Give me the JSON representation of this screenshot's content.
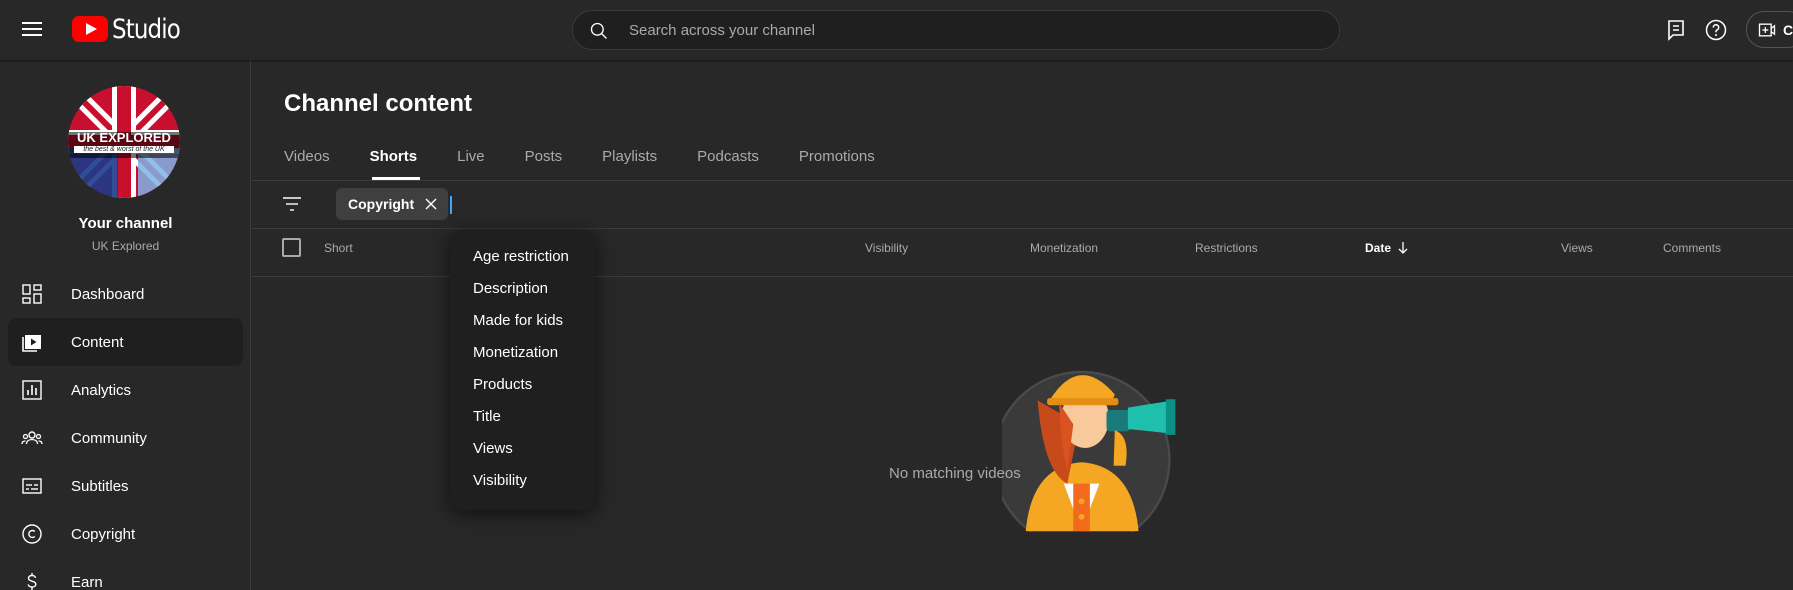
{
  "app": {
    "brand": "Studio"
  },
  "search": {
    "placeholder": "Search across your channel"
  },
  "topbar": {
    "create_label": "C"
  },
  "channel": {
    "name": "Your channel",
    "handle": "UK Explored",
    "avatar_text_main": "UK EXPLORED",
    "avatar_text_sub": "the best & worst of the UK"
  },
  "sidebar": {
    "items": [
      {
        "label": "Dashboard",
        "icon": "dashboard-icon"
      },
      {
        "label": "Content",
        "icon": "content-icon",
        "active": true
      },
      {
        "label": "Analytics",
        "icon": "analytics-icon"
      },
      {
        "label": "Community",
        "icon": "community-icon"
      },
      {
        "label": "Subtitles",
        "icon": "subtitles-icon"
      },
      {
        "label": "Copyright",
        "icon": "copyright-icon"
      },
      {
        "label": "Earn",
        "icon": "earn-icon"
      }
    ]
  },
  "main": {
    "title": "Channel content",
    "tabs": [
      "Videos",
      "Shorts",
      "Live",
      "Posts",
      "Playlists",
      "Podcasts",
      "Promotions"
    ],
    "active_tab": "Shorts",
    "filter_chip": "Copyright",
    "columns": [
      "Short",
      "Visibility",
      "Monetization",
      "Restrictions",
      "Date",
      "Views",
      "Comments"
    ],
    "sorted_column": "Date",
    "empty_text": "No matching videos"
  },
  "dropdown": {
    "items": [
      "Age restriction",
      "Description",
      "Made for kids",
      "Monetization",
      "Products",
      "Title",
      "Views",
      "Visibility"
    ]
  },
  "colors": {
    "accent": "#3ea6ff",
    "brand_red": "#ff0000",
    "background": "#282828"
  }
}
